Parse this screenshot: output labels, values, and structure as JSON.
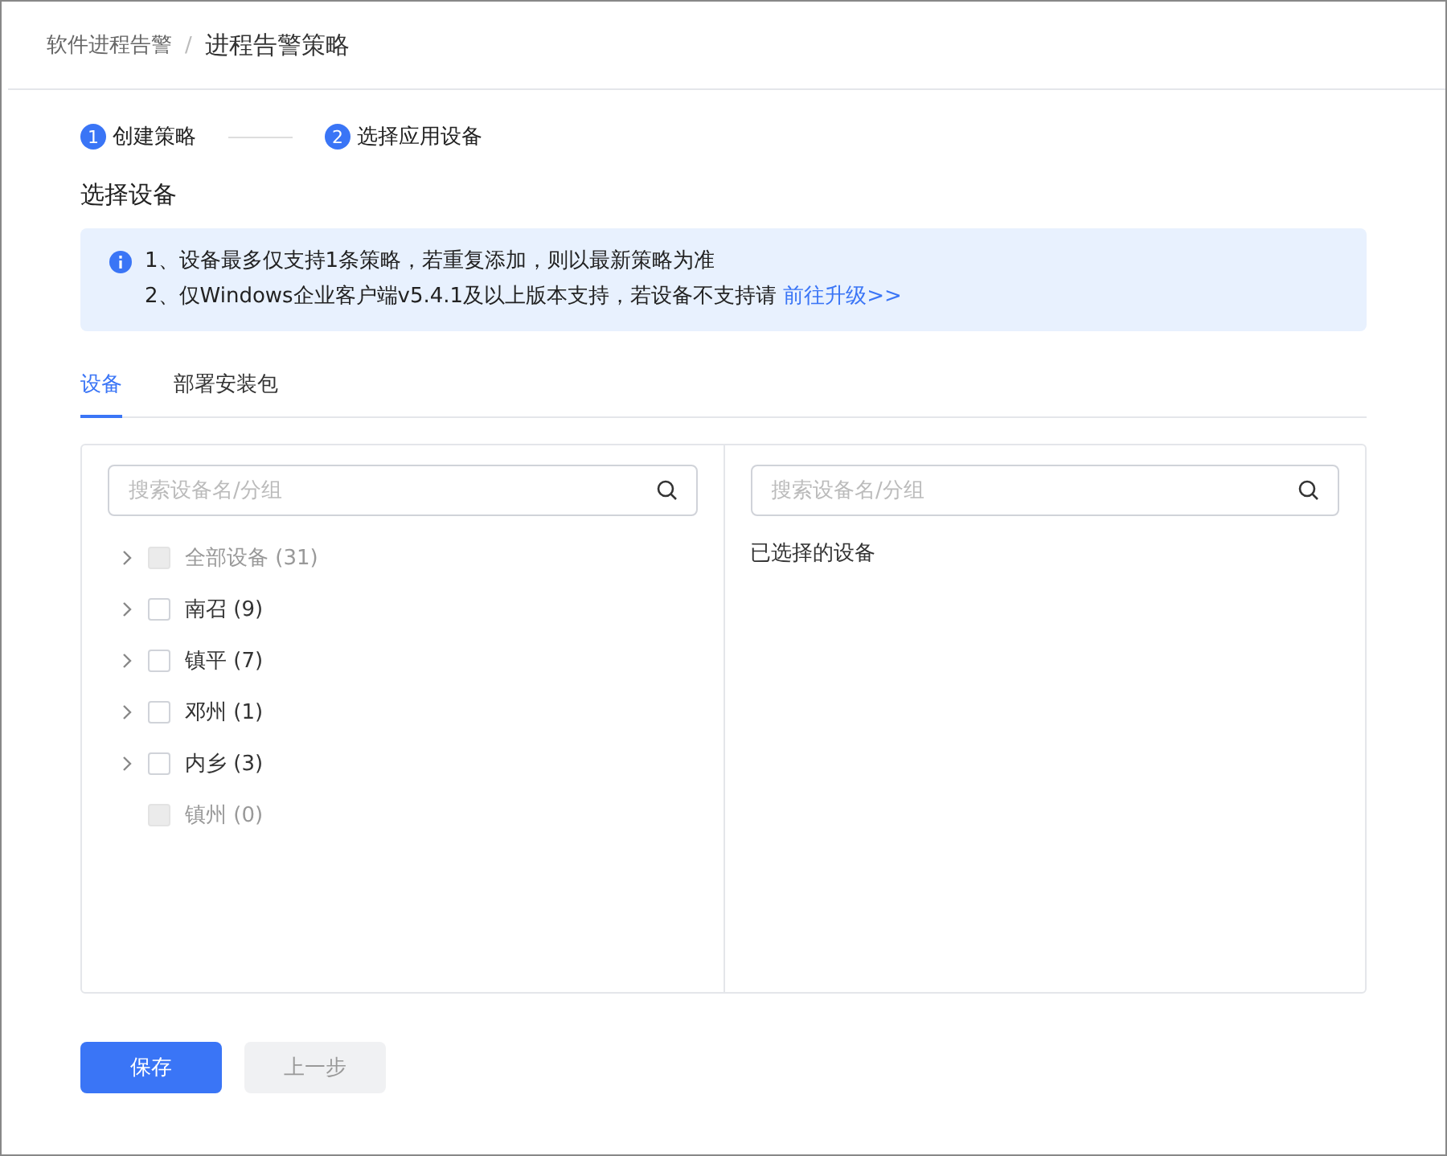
{
  "breadcrumb": [
    {
      "label": "软件进程告警",
      "current": false
    },
    {
      "label": "进程告警策略",
      "current": true
    }
  ],
  "breadcrumb_separator": "/",
  "steps": [
    {
      "number": "1",
      "label": "创建策略"
    },
    {
      "number": "2",
      "label": "选择应用设备"
    }
  ],
  "section_title": "选择设备",
  "notice": {
    "lines": [
      {
        "text": "1、设备最多仅支持1条策略，若重复添加，则以最新策略为准"
      },
      {
        "text": "2、仅Windows企业客户端v5.4.1及以上版本支持，若设备不支持请",
        "link": "前往升级>>"
      }
    ]
  },
  "tabs": [
    {
      "label": "设备",
      "selected": true
    },
    {
      "label": "部署安装包",
      "selected": false
    }
  ],
  "left_panel": {
    "search": {
      "placeholder": "搜索设备名/分组"
    },
    "tree": [
      {
        "label": "全部设备 (31)",
        "expandable": true,
        "checked": false,
        "disabled": true
      },
      {
        "label": "南召 (9)",
        "expandable": true,
        "checked": false,
        "disabled": false
      },
      {
        "label": "镇平 (7)",
        "expandable": true,
        "checked": false,
        "disabled": false
      },
      {
        "label": "邓州 (1)",
        "expandable": true,
        "checked": false,
        "disabled": false
      },
      {
        "label": "内乡 (3)",
        "expandable": true,
        "checked": false,
        "disabled": false
      },
      {
        "label": "镇州 (0)",
        "expandable": false,
        "checked": false,
        "disabled": true
      }
    ]
  },
  "right_panel": {
    "search": {
      "placeholder": "搜索设备名/分组"
    },
    "title": "已选择的设备"
  },
  "buttons": [
    {
      "label": "保存",
      "kind": "primary",
      "disabled": false
    },
    {
      "label": "上一步",
      "kind": "secondary",
      "disabled": true
    }
  ]
}
